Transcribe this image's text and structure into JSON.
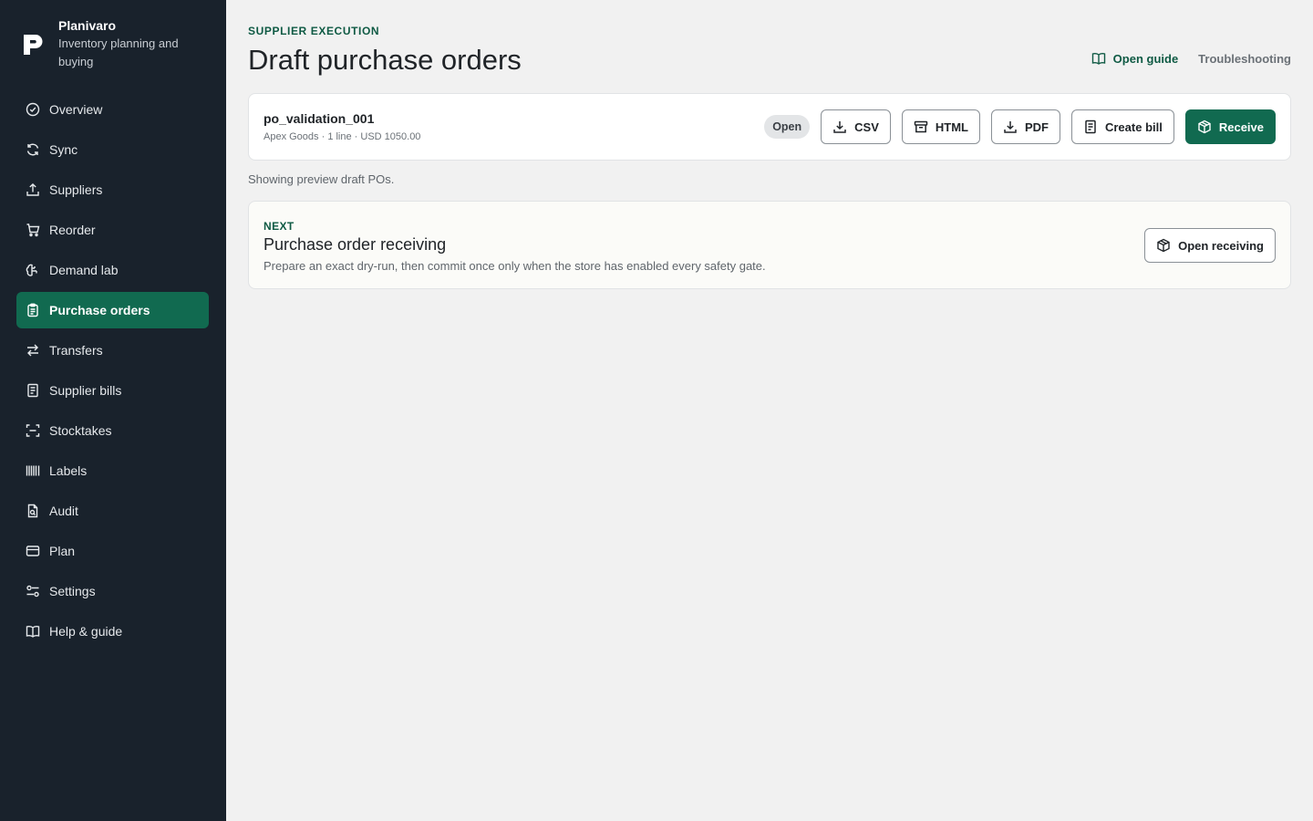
{
  "app": {
    "name": "Planivaro",
    "tagline": "Inventory planning and buying"
  },
  "sidebar": {
    "items": [
      {
        "label": "Overview",
        "icon": "check-circle-icon"
      },
      {
        "label": "Sync",
        "icon": "refresh-icon"
      },
      {
        "label": "Suppliers",
        "icon": "upload-icon"
      },
      {
        "label": "Reorder",
        "icon": "cart-icon"
      },
      {
        "label": "Demand lab",
        "icon": "brain-icon"
      },
      {
        "label": "Purchase orders",
        "icon": "clipboard-icon",
        "active": true
      },
      {
        "label": "Transfers",
        "icon": "arrows-swap-icon"
      },
      {
        "label": "Supplier bills",
        "icon": "receipt-icon"
      },
      {
        "label": "Stocktakes",
        "icon": "scan-icon"
      },
      {
        "label": "Labels",
        "icon": "barcode-icon"
      },
      {
        "label": "Audit",
        "icon": "file-search-icon"
      },
      {
        "label": "Plan",
        "icon": "credit-card-icon"
      },
      {
        "label": "Settings",
        "icon": "sliders-icon"
      },
      {
        "label": "Help & guide",
        "icon": "book-icon"
      }
    ]
  },
  "header": {
    "eyebrow": "SUPPLIER EXECUTION",
    "title": "Draft purchase orders",
    "guide_label": "Open guide",
    "troubleshooting_label": "Troubleshooting"
  },
  "po": {
    "id": "po_validation_001",
    "meta": "Apex Goods · 1 line · USD 1050.00",
    "status": "Open",
    "actions": {
      "csv": "CSV",
      "html": "HTML",
      "pdf": "PDF",
      "create_bill": "Create bill",
      "receive": "Receive"
    }
  },
  "preview_note": "Showing preview draft POs.",
  "next": {
    "label": "NEXT",
    "title": "Purchase order receiving",
    "description": "Prepare an exact dry-run, then commit once only when the store has enabled every safety gate.",
    "button": "Open receiving"
  },
  "colors": {
    "sidebar_bg": "#19222c",
    "accent": "#116a50",
    "accent_text": "#0f5a44",
    "page_bg": "#f1f1f1"
  }
}
